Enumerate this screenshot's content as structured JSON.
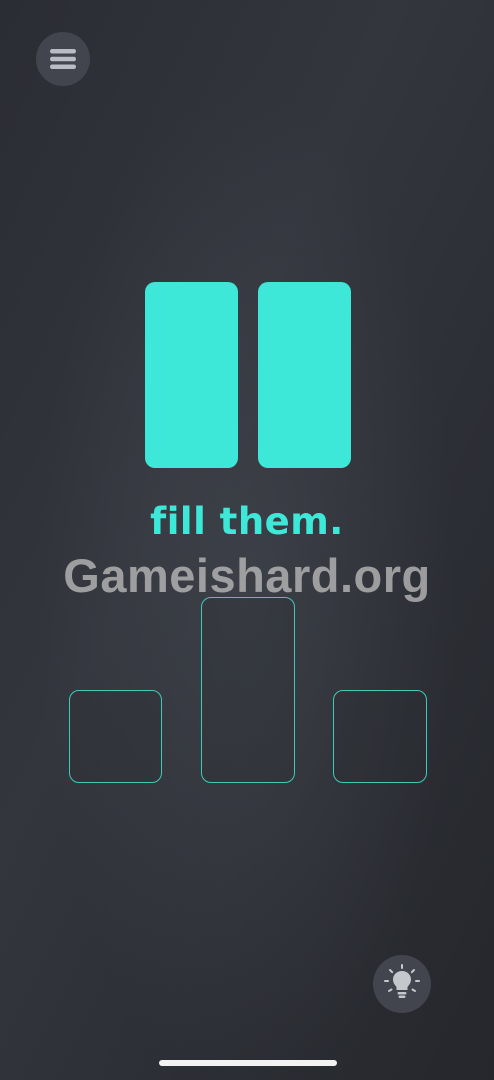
{
  "hint_text": "fill them.",
  "watermark": "Gameishard.org",
  "icons": {
    "menu": "hamburger-menu-icon",
    "hint": "lightbulb-icon"
  },
  "colors": {
    "accent": "#3de8d8",
    "slot_outline": "#3fc9b9",
    "background": "#2c2f35",
    "button_bg": "#42454d"
  }
}
